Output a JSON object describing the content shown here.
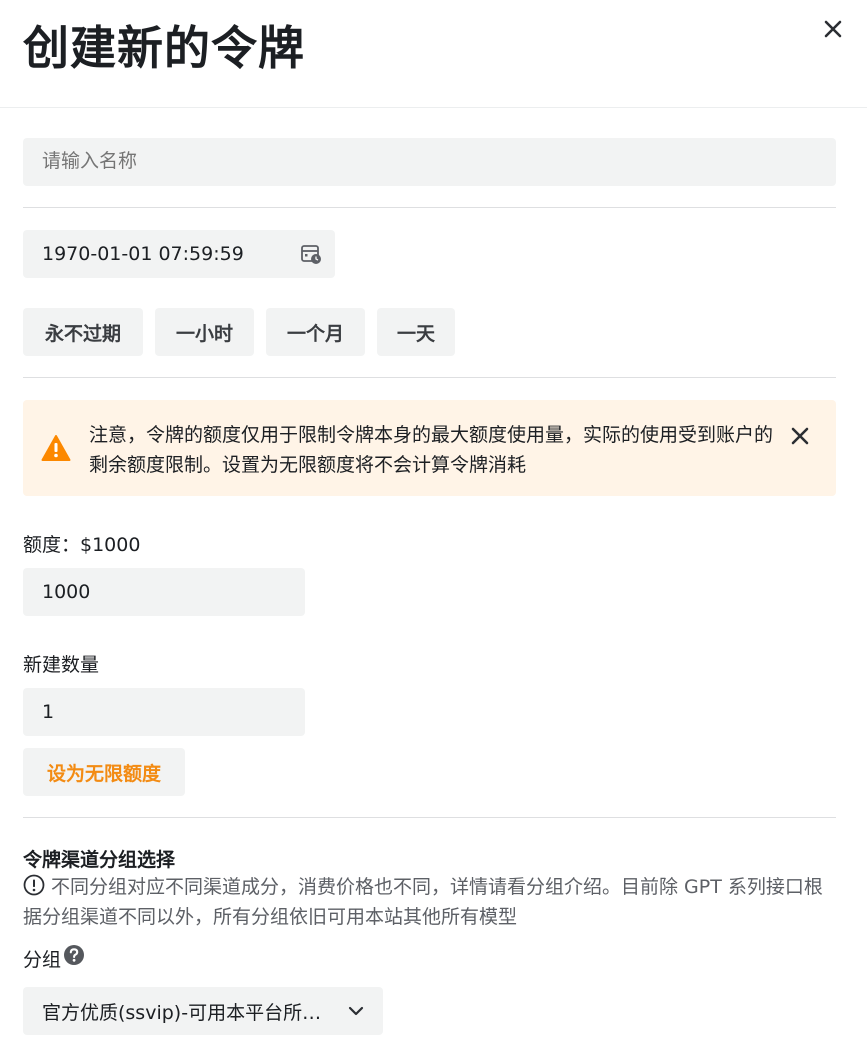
{
  "dialog": {
    "title": "创建新的令牌",
    "close_icon": "close-icon"
  },
  "name_field": {
    "placeholder": "请输入名称",
    "value": ""
  },
  "expiry": {
    "value": "1970-01-01 07:59:59",
    "icon": "calendar-clock-icon",
    "quick_options": [
      "永不过期",
      "一小时",
      "一个月",
      "一天"
    ]
  },
  "notice": {
    "text": "注意，令牌的额度仅用于限制令牌本身的最大额度使用量，实际的使用受到账户的剩余额度限制。设置为无限额度将不会计算令牌消耗",
    "icon": "warning-icon",
    "color": "#fff4e7",
    "icon_color": "#fc8800"
  },
  "quota": {
    "label": "额度：$1000",
    "value": "1000"
  },
  "count": {
    "label": "新建数量",
    "value": "1"
  },
  "unlimited_button": {
    "label": "设为无限额度",
    "color": "#f38b13"
  },
  "group_section": {
    "title": "令牌渠道分组选择",
    "help": "不同分组对应不同渠道成分，消费价格也不同，详情请看分组介绍。目前除 GPT 系列接口根据分组渠道不同以外，所有分组依旧可用本站其他所有模型",
    "group_label": "分组",
    "selected": "官方优质(ssvip)-可用本平台所有模型"
  }
}
